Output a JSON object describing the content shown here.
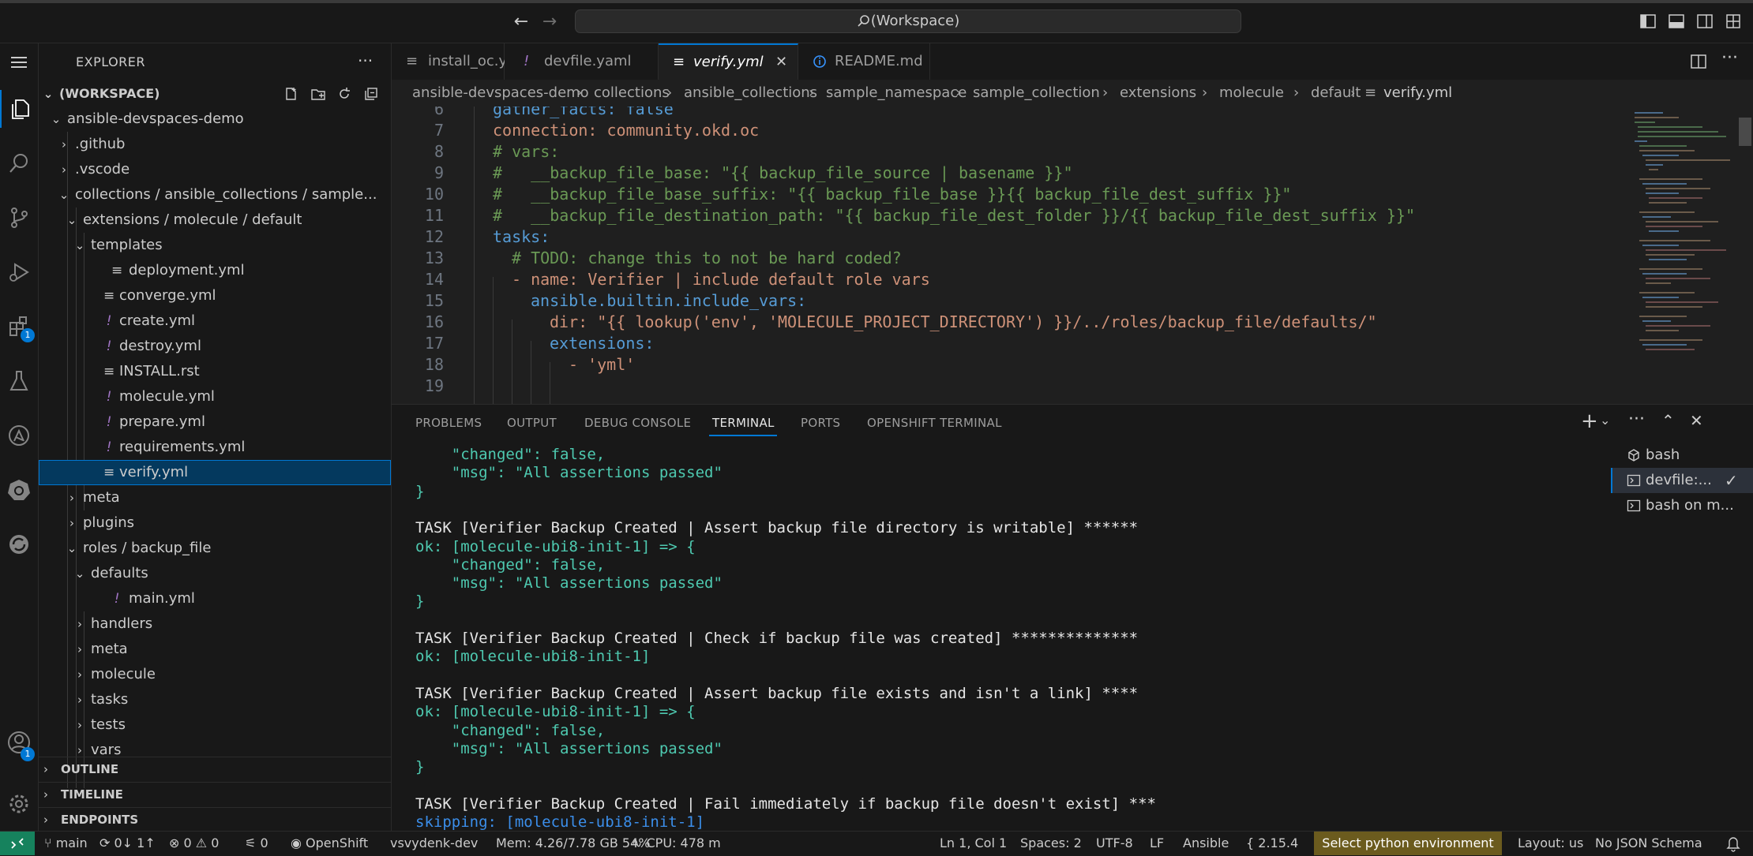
{
  "title_bar": {
    "search_text": "(Workspace)"
  },
  "activity_bar": {
    "extensions_badge": "1",
    "accounts_badge": "1"
  },
  "sidebar": {
    "header": "EXPLORER",
    "workspace_label": "(WORKSPACE)",
    "tree": [
      {
        "label": "ansible-devspaces-demo",
        "type": "folder-open"
      },
      {
        "label": ".github",
        "type": "folder"
      },
      {
        "label": ".vscode",
        "type": "folder"
      },
      {
        "label": "collections / ansible_collections / sample...",
        "type": "folder-open"
      },
      {
        "label": "extensions / molecule / default",
        "type": "folder-open"
      },
      {
        "label": "templates",
        "type": "folder-open"
      },
      {
        "label": "deployment.yml",
        "type": "file"
      },
      {
        "label": "converge.yml",
        "type": "file"
      },
      {
        "label": "create.yml",
        "type": "yaml"
      },
      {
        "label": "destroy.yml",
        "type": "yaml"
      },
      {
        "label": "INSTALL.rst",
        "type": "file"
      },
      {
        "label": "molecule.yml",
        "type": "yaml"
      },
      {
        "label": "prepare.yml",
        "type": "yaml"
      },
      {
        "label": "requirements.yml",
        "type": "yaml"
      },
      {
        "label": "verify.yml",
        "type": "file"
      },
      {
        "label": "meta",
        "type": "folder"
      },
      {
        "label": "plugins",
        "type": "folder"
      },
      {
        "label": "roles / backup_file",
        "type": "folder-open"
      },
      {
        "label": "defaults",
        "type": "folder-open"
      },
      {
        "label": "main.yml",
        "type": "yaml"
      },
      {
        "label": "handlers",
        "type": "folder"
      },
      {
        "label": "meta",
        "type": "folder"
      },
      {
        "label": "molecule",
        "type": "folder"
      },
      {
        "label": "tasks",
        "type": "folder"
      },
      {
        "label": "tests",
        "type": "folder"
      },
      {
        "label": "vars",
        "type": "folder"
      }
    ],
    "sections": [
      "OUTLINE",
      "TIMELINE",
      "ENDPOINTS"
    ]
  },
  "tabs": [
    {
      "label": "install_oc.yml",
      "icon": "lines"
    },
    {
      "label": "devfile.yaml",
      "icon": "exclaim"
    },
    {
      "label": "verify.yml",
      "icon": "lines"
    },
    {
      "label": "README.md",
      "icon": "info"
    }
  ],
  "breadcrumb": [
    "ansible-devspaces-demo",
    "collections",
    "ansible_collections",
    "sample_namespace",
    "sample_collection",
    "extensions",
    "molecule",
    "default",
    "verify.yml"
  ],
  "code": [
    {
      "n": "6",
      "text": "gather_facts: false"
    },
    {
      "n": "7",
      "text": "connection: community.okd.oc"
    },
    {
      "n": "8",
      "text": "# vars:"
    },
    {
      "n": "9",
      "text": "#   __backup_file_base: \"{{ backup_file_source | basename }}\""
    },
    {
      "n": "10",
      "text": "#   __backup_file_base_suffix: \"{{ backup_file_base }}{{ backup_file_dest_suffix }}\""
    },
    {
      "n": "11",
      "text": "#   __backup_file_destination_path: \"{{ backup_file_dest_folder }}/{{ backup_file_dest_suffix }}\""
    },
    {
      "n": "12",
      "text": "tasks:"
    },
    {
      "n": "13",
      "text": "# TODO: change this to not be hard coded?"
    },
    {
      "n": "14",
      "text": "- name: Verifier | include default role vars"
    },
    {
      "n": "15",
      "text": "ansible.builtin.include_vars:"
    },
    {
      "n": "16",
      "text": "dir: \"{{ lookup('env', 'MOLECULE_PROJECT_DIRECTORY') }}/../roles/backup_file/defaults/\""
    },
    {
      "n": "17",
      "text": "extensions:"
    },
    {
      "n": "18",
      "text": "- 'yml'"
    },
    {
      "n": "19",
      "text": ""
    }
  ],
  "panel": {
    "tabs": [
      "PROBLEMS",
      "OUTPUT",
      "DEBUG CONSOLE",
      "TERMINAL",
      "PORTS",
      "OPENSHIFT TERMINAL"
    ],
    "active_tab": "TERMINAL",
    "terminal_lines": [
      {
        "t": "    \"changed\": false,",
        "c": "g"
      },
      {
        "t": "    \"msg\": \"All assertions passed\"",
        "c": "g"
      },
      {
        "t": "}",
        "c": "g"
      },
      {
        "t": "",
        "c": "w"
      },
      {
        "t": "TASK [Verifier Backup Created | Assert backup file directory is writable] ******",
        "c": "w"
      },
      {
        "t": "ok: [molecule-ubi8-init-1] => {",
        "c": "g"
      },
      {
        "t": "    \"changed\": false,",
        "c": "g"
      },
      {
        "t": "    \"msg\": \"All assertions passed\"",
        "c": "g"
      },
      {
        "t": "}",
        "c": "g"
      },
      {
        "t": "",
        "c": "w"
      },
      {
        "t": "TASK [Verifier Backup Created | Check if backup file was created] **************",
        "c": "w"
      },
      {
        "t": "ok: [molecule-ubi8-init-1]",
        "c": "g"
      },
      {
        "t": "",
        "c": "w"
      },
      {
        "t": "TASK [Verifier Backup Created | Assert backup file exists and isn't a link] ****",
        "c": "w"
      },
      {
        "t": "ok: [molecule-ubi8-init-1] => {",
        "c": "g"
      },
      {
        "t": "    \"changed\": false,",
        "c": "g"
      },
      {
        "t": "    \"msg\": \"All assertions passed\"",
        "c": "g"
      },
      {
        "t": "}",
        "c": "g"
      },
      {
        "t": "",
        "c": "w"
      },
      {
        "t": "TASK [Verifier Backup Created | Fail immediately if backup file doesn't exist] ***",
        "c": "w"
      },
      {
        "t": "skipping: [molecule-ubi8-init-1]",
        "c": "b"
      }
    ],
    "terminals": [
      {
        "label": "bash"
      },
      {
        "label": "devfile:..."
      },
      {
        "label": "bash on m..."
      }
    ]
  },
  "status_bar": {
    "branch": "main",
    "sync": "0↓ 1↑",
    "errors": "0",
    "warnings": "0",
    "ports": "0",
    "openshift": "OpenShift",
    "namespace": "vsvydenk-dev",
    "memory": "Mem: 4.26/7.78 GB 54%",
    "cpu": "CPU: 478 m",
    "position": "Ln 1, Col 1",
    "spaces": "Spaces: 2",
    "encoding": "UTF-8",
    "eol": "LF",
    "language": "Ansible",
    "ansible_version": "2.15.4",
    "python_env": "Select python environment",
    "layout": "Layout: us",
    "schema": "No JSON Schema"
  },
  "colors": {
    "accent": "#0078d4",
    "python_env_bg": "#6b5b1e",
    "remote_bg": "#16825d"
  }
}
